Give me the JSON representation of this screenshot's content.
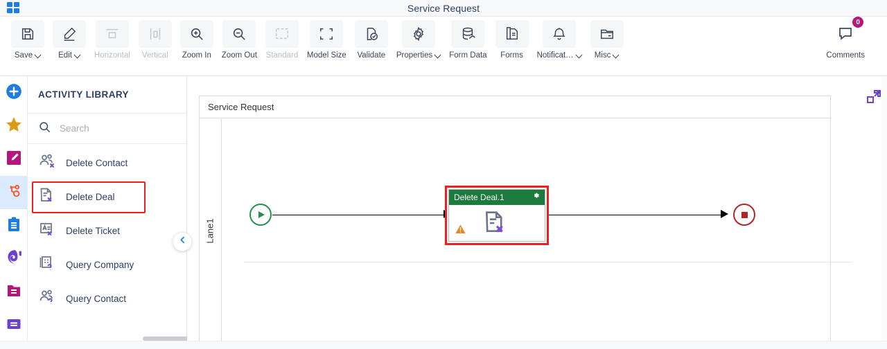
{
  "titlebar": {
    "app_menu_icon": "waffle-grid-icon",
    "title": "Service Request"
  },
  "toolbar": {
    "items": [
      {
        "label": "Save",
        "icon": "save-floppy-icon",
        "dropdown": true,
        "disabled": false
      },
      {
        "label": "Edit",
        "icon": "pencil-edit-icon",
        "dropdown": true,
        "disabled": false
      },
      {
        "label": "Horizontal",
        "icon": "horizontal-align-icon",
        "dropdown": false,
        "disabled": true
      },
      {
        "label": "Vertical",
        "icon": "vertical-align-icon",
        "dropdown": false,
        "disabled": true
      },
      {
        "label": "Zoom In",
        "icon": "zoom-in-icon",
        "dropdown": false,
        "disabled": false
      },
      {
        "label": "Zoom Out",
        "icon": "zoom-out-icon",
        "dropdown": false,
        "disabled": false
      },
      {
        "label": "Standard",
        "icon": "standard-size-icon",
        "dropdown": false,
        "disabled": true
      },
      {
        "label": "Model Size",
        "icon": "model-size-icon",
        "dropdown": false,
        "disabled": false
      },
      {
        "label": "Validate",
        "icon": "validate-check-icon",
        "dropdown": false,
        "disabled": false
      },
      {
        "label": "Properties",
        "icon": "gear-icon",
        "dropdown": true,
        "disabled": false
      },
      {
        "label": "Form Data",
        "icon": "database-icon",
        "dropdown": false,
        "disabled": false
      },
      {
        "label": "Forms",
        "icon": "document-copy-icon",
        "dropdown": false,
        "disabled": false
      },
      {
        "label": "Notificat…",
        "icon": "bell-icon",
        "dropdown": true,
        "disabled": false
      },
      {
        "label": "Misc",
        "icon": "folder-icon",
        "dropdown": true,
        "disabled": false
      }
    ],
    "comments": {
      "label": "Comments",
      "icon": "comment-bubble-icon",
      "count": "0",
      "badge_color": "#b3167d"
    }
  },
  "rail": {
    "items": [
      {
        "name": "add-new",
        "icon": "plus-circle-icon",
        "color": "#1c7fe0",
        "active": false
      },
      {
        "name": "favorites",
        "icon": "star-icon",
        "color": "#d99c12",
        "active": false
      },
      {
        "name": "design",
        "icon": "pencil-square-icon",
        "color": "#b3167d",
        "active": false
      },
      {
        "name": "hubspot",
        "icon": "hubspot-sprocket-icon",
        "color": "#f5602a",
        "active": true
      },
      {
        "name": "tasks",
        "icon": "clipboard-icon",
        "color": "#1c7fe0",
        "active": false
      },
      {
        "name": "analytics",
        "icon": "swirl-icon",
        "color": "#6b3fd4",
        "active": false
      },
      {
        "name": "files",
        "icon": "folder-lines-icon",
        "color": "#b3167d",
        "active": false
      },
      {
        "name": "list",
        "icon": "list-card-icon",
        "color": "#6b3fd4",
        "active": false
      }
    ]
  },
  "library": {
    "header": "ACTIVITY LIBRARY",
    "search": {
      "placeholder": "Search",
      "value": "",
      "icon": "search-icon"
    },
    "items": [
      {
        "label": "Delete Contact",
        "icon": "delete-contact-icon",
        "highlighted": false
      },
      {
        "label": "Delete Deal",
        "icon": "delete-deal-icon",
        "highlighted": true
      },
      {
        "label": "Delete Ticket",
        "icon": "delete-ticket-icon",
        "highlighted": false
      },
      {
        "label": "Query Company",
        "icon": "query-company-icon",
        "highlighted": false
      },
      {
        "label": "Query Contact",
        "icon": "query-contact-icon",
        "highlighted": false
      }
    ],
    "collapse_icon": "chevron-left-icon"
  },
  "canvas": {
    "expand_icon": "expand-fullscreen-icon",
    "pool_title": "Service Request",
    "lane_label": "Lane1",
    "start_event": {
      "name": "start-event",
      "icon": "play-triangle-icon",
      "color": "#2a8f4e"
    },
    "end_event": {
      "name": "end-event",
      "icon": "stop-square-icon",
      "color": "#b32424"
    },
    "task": {
      "title": "Delete Deal.1",
      "header_color": "#1d7a3d",
      "selection_color": "#f01f1f",
      "gear_icon": "gear-icon",
      "warning_icon": "warning-triangle-icon",
      "body_icon": "delete-deal-icon"
    }
  },
  "colors": {
    "accent_blue": "#1c7fe0",
    "title_text": "#2c3e66",
    "selection_red": "#f01f1f",
    "task_green": "#1d7a3d",
    "warning_orange": "#e8871a",
    "icon_gray": "#6b7489",
    "icon_purple": "#6b3fd4"
  }
}
